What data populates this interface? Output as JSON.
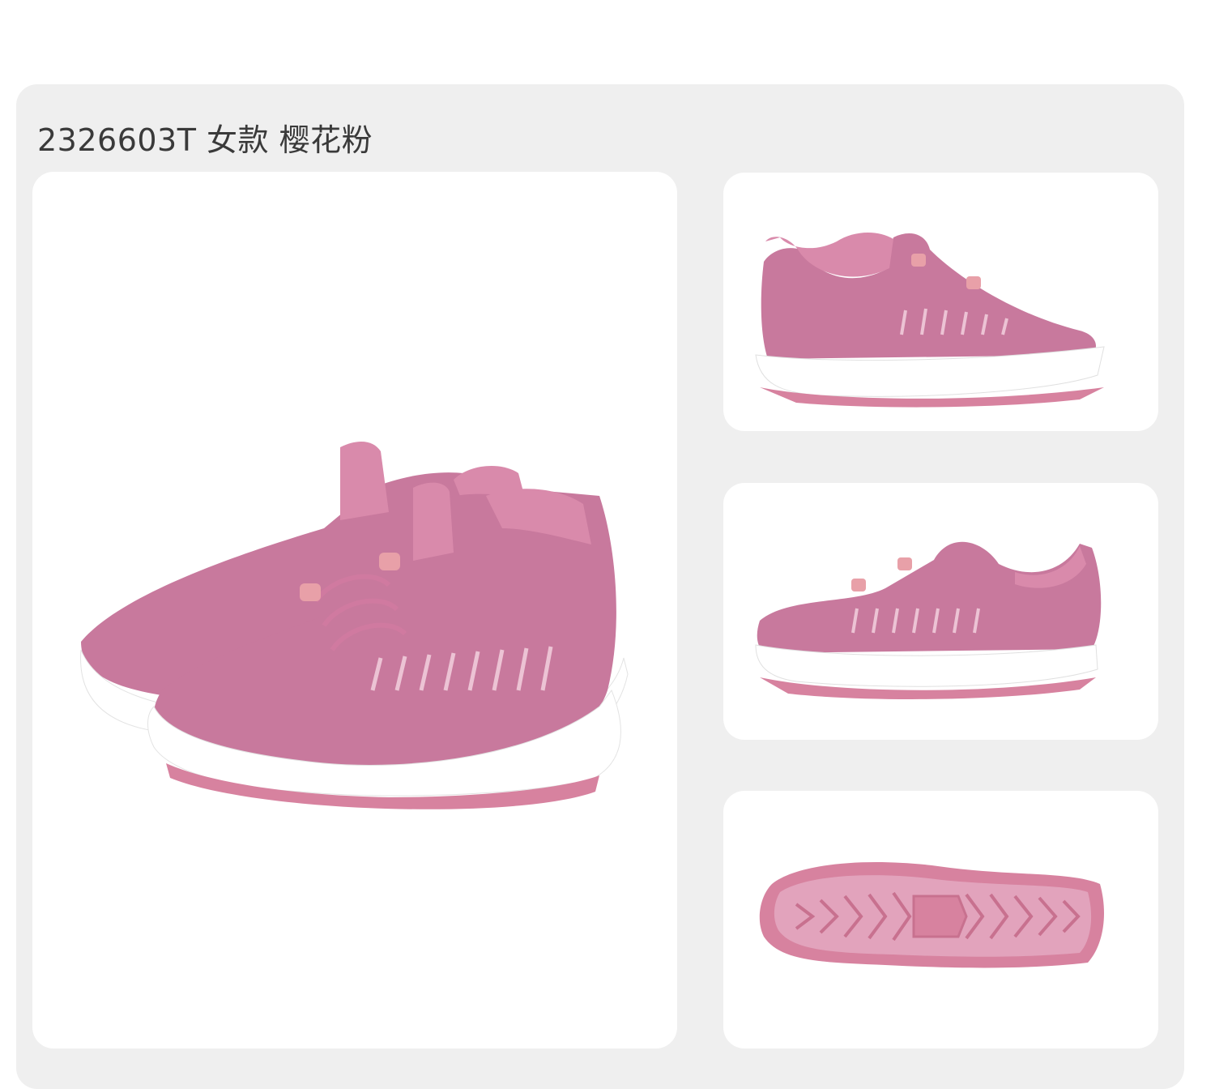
{
  "product": {
    "title": "2326603T 女款 樱花粉"
  },
  "colors": {
    "background": "#efefef",
    "panel": "#ffffff",
    "upper": "#c8799d",
    "upper_dark": "#a85a82",
    "lining": "#d98aab",
    "sole": "#ffffff",
    "outsole": "#d7829f",
    "toggle": "#e8a0a8"
  },
  "images": [
    {
      "name": "main-pair-view"
    },
    {
      "name": "side-view"
    },
    {
      "name": "front-quarter-view"
    },
    {
      "name": "outsole-view"
    }
  ]
}
